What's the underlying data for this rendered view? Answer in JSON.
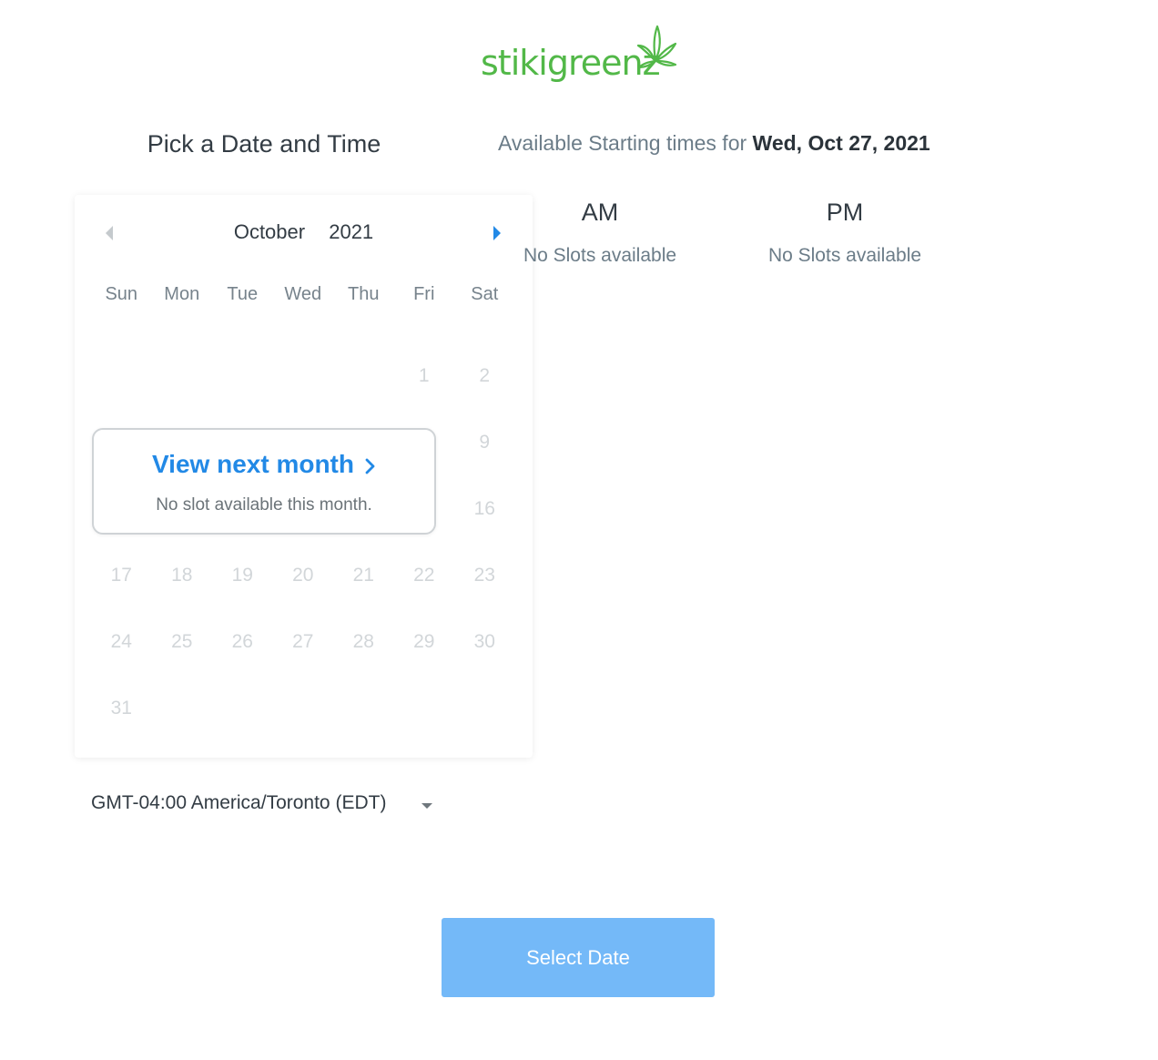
{
  "logo": {
    "text": "stikigreenz",
    "icon": "cannabis-leaf-icon",
    "color": "#52b848"
  },
  "left_title": "Pick a Date and Time",
  "availability": {
    "prefix": "Available Starting times for",
    "date": "Wed, Oct 27, 2021"
  },
  "calendar": {
    "month": "October",
    "year": "2021",
    "prev_icon": "chevron-left-icon",
    "next_icon": "chevron-right-icon",
    "weekdays": [
      "Sun",
      "Mon",
      "Tue",
      "Wed",
      "Thu",
      "Fri",
      "Sat"
    ],
    "weeks": [
      [
        "",
        "",
        "",
        "",
        "",
        "1",
        "2"
      ],
      [
        "",
        "",
        "",
        "",
        "",
        "",
        "9"
      ],
      [
        "",
        "",
        "",
        "",
        "",
        "",
        "16"
      ],
      [
        "17",
        "18",
        "19",
        "20",
        "21",
        "22",
        "23"
      ],
      [
        "24",
        "25",
        "26",
        "27",
        "28",
        "29",
        "30"
      ],
      [
        "31",
        "",
        "",
        "",
        "",
        "",
        ""
      ]
    ]
  },
  "popup": {
    "link_label": "View next month",
    "message": "No slot available this month."
  },
  "am": {
    "heading": "AM",
    "message": "No Slots available"
  },
  "pm": {
    "heading": "PM",
    "message": "No Slots available"
  },
  "timezone": {
    "value": "GMT-04:00 America/Toronto (EDT)"
  },
  "select_button": {
    "label": "Select Date",
    "color": "#74b9f8"
  },
  "accent_color": "#2289e6"
}
